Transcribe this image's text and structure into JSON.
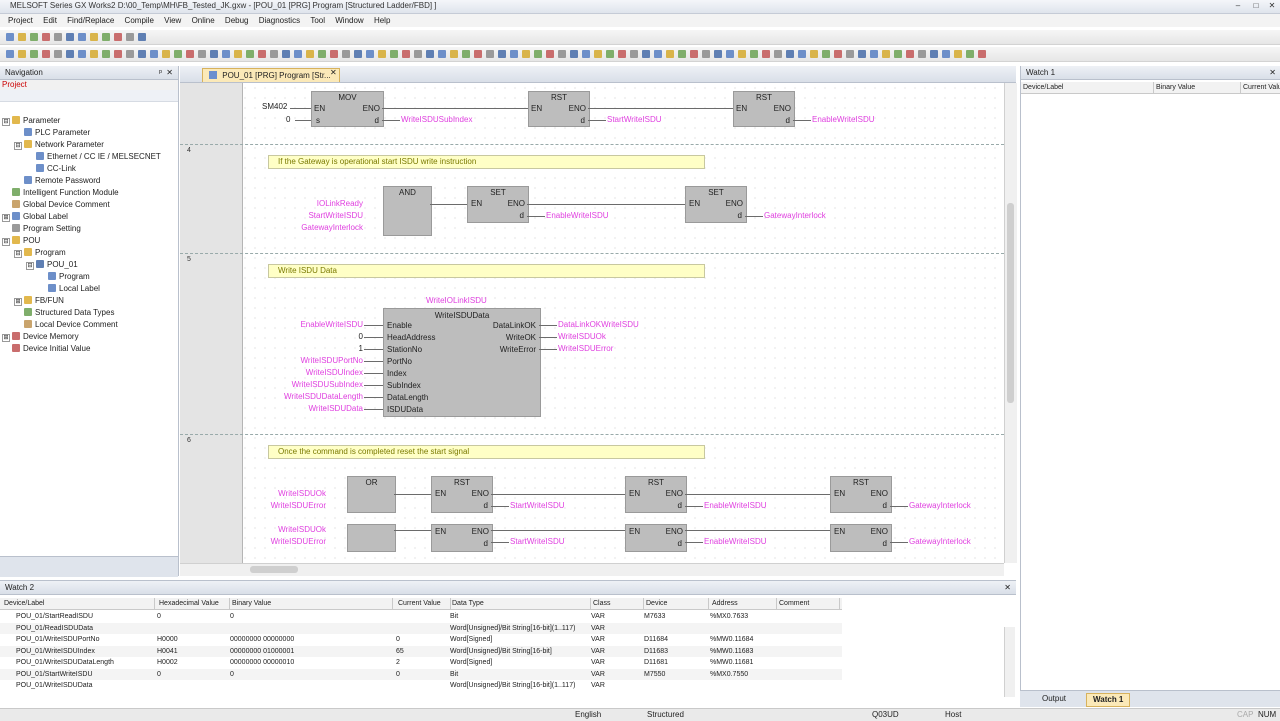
{
  "window": {
    "title": "MELSOFT Series GX Works2 D:\\00_Temp\\MH\\FB_Tested_JK.gxw - [POU_01 [PRG] Program [Structured Ladder/FBD] ]",
    "minimize": "–",
    "restore": "□",
    "close": "✕"
  },
  "menu": [
    "Project",
    "Edit",
    "Find/Replace",
    "Compile",
    "View",
    "Online",
    "Debug",
    "Diagnostics",
    "Tool",
    "Window",
    "Help"
  ],
  "nav": {
    "title": "Navigation",
    "pin": "ᵖ",
    "close": "✕",
    "project_label": "Project",
    "tree": [
      {
        "label": "Parameter",
        "level": 0,
        "expander": "⊟",
        "icon": "folder-icon"
      },
      {
        "label": "PLC Parameter",
        "level": 1,
        "expander": "",
        "icon": "param-icon"
      },
      {
        "label": "Network Parameter",
        "level": 1,
        "expander": "⊟",
        "icon": "folder-icon"
      },
      {
        "label": "Ethernet / CC IE / MELSECNET",
        "level": 2,
        "expander": "",
        "icon": "param-icon"
      },
      {
        "label": "CC-Link",
        "level": 2,
        "expander": "",
        "icon": "param-icon"
      },
      {
        "label": "Remote Password",
        "level": 1,
        "expander": "",
        "icon": "param-icon"
      },
      {
        "label": "Intelligent Function Module",
        "level": 0,
        "expander": "",
        "icon": "module-icon"
      },
      {
        "label": "Global Device Comment",
        "level": 0,
        "expander": "",
        "icon": "comment-icon"
      },
      {
        "label": "Global Label",
        "level": 0,
        "expander": "⊞",
        "icon": "label-icon"
      },
      {
        "label": "Program Setting",
        "level": 0,
        "expander": "",
        "icon": "setting-icon"
      },
      {
        "label": "POU",
        "level": 0,
        "expander": "⊟",
        "icon": "folder-icon"
      },
      {
        "label": "Program",
        "level": 1,
        "expander": "⊟",
        "icon": "folder-icon"
      },
      {
        "label": "POU_01",
        "level": 2,
        "expander": "⊟",
        "icon": "program-icon"
      },
      {
        "label": "Program",
        "level": 3,
        "expander": "",
        "icon": "ladder-icon"
      },
      {
        "label": "Local Label",
        "level": 3,
        "expander": "",
        "icon": "label-icon"
      },
      {
        "label": "FB/FUN",
        "level": 1,
        "expander": "⊞",
        "icon": "folder-icon"
      },
      {
        "label": "Structured Data Types",
        "level": 1,
        "expander": "",
        "icon": "struct-icon"
      },
      {
        "label": "Local Device Comment",
        "level": 1,
        "expander": "",
        "icon": "comment-icon"
      },
      {
        "label": "Device Memory",
        "level": 0,
        "expander": "⊞",
        "icon": "memory-icon"
      },
      {
        "label": "Device Initial Value",
        "level": 0,
        "expander": "",
        "icon": "memory-icon"
      }
    ]
  },
  "editor": {
    "tab": "POU_01 [PRG] Program [Str...",
    "tab_close": "✕",
    "row_numbers": [
      "4",
      "5",
      "6"
    ],
    "comments": [
      "If the Gateway is operational start ISDU write instruction",
      "Write ISDU Data",
      "Once the command is completed reset the start signal"
    ],
    "row3": {
      "contact": "SM402",
      "mov_name": "MOV",
      "zero": "0",
      "mov_out": "WriteISDUSubIndex",
      "rst1_out": "StartWriteISDU",
      "rst2_out": "EnableWriteISDU"
    },
    "row4": {
      "and_name": "AND",
      "in1": "IOLinkReady",
      "in2": "StartWriteISDU",
      "in3": "GatewayInterlock",
      "set1_out": "EnableWriteISDU",
      "set2_out": "GatewayInterlock"
    },
    "row5": {
      "instance": "WriteIOLinkISDU",
      "fb_name": "WriteISDUData",
      "inputs": [
        "Enable",
        "HeadAddress",
        "StationNo",
        "PortNo",
        "Index",
        "SubIndex",
        "DataLength",
        "ISDUData"
      ],
      "input_vars": [
        "EnableWriteISDU",
        "0",
        "1",
        "WriteISDUPortNo",
        "WriteISDUIndex",
        "WriteISDUSubIndex",
        "WriteISDUDataLength",
        "WriteISDUData"
      ],
      "outputs": [
        "DataLinkOK",
        "WriteOK",
        "WriteError"
      ],
      "output_vars": [
        "DataLinkOKWriteISDU",
        "WriteISDUOk",
        "WriteISDUError"
      ]
    },
    "row6": {
      "or_name": "OR",
      "in1": "WriteISDUOk",
      "in2": "WriteISDUError",
      "rst1_out": "StartWriteISDU",
      "rst2_out": "EnableWriteISDU",
      "rst3_out": "GatewayInterlock"
    },
    "row7": {
      "in1": "WriteISDUOk",
      "in2": "WriteISDUError",
      "rst1_out": "StartWriteISDU",
      "rst2_out": "EnableWriteISDU",
      "rst3_out": "GatewayInterlock"
    },
    "pins": {
      "en": "EN",
      "eno": "ENO",
      "d": "d",
      "s": "s",
      "rst": "RST",
      "set": "SET"
    }
  },
  "watch1": {
    "title": "Watch 1",
    "columns": [
      "Device/Label",
      "Binary Value",
      "Current Value"
    ],
    "tabs": [
      "Output",
      "Watch 1"
    ]
  },
  "watch2": {
    "title": "Watch 2",
    "columns": [
      "Device/Label",
      "Hexadecimal Value",
      "Binary Value",
      "Current Value",
      "Data Type",
      "Class",
      "Device",
      "Address",
      "Comment"
    ],
    "rows": [
      [
        "POU_01/StartReadISDU",
        "0",
        "0",
        "",
        "Bit",
        "VAR",
        "M7633",
        "%MX0.7633",
        ""
      ],
      [
        "POU_01/ReadISDUData",
        "",
        "",
        "",
        "Word[Unsigned]/Bit String[16-bit](1..117)",
        "VAR",
        "",
        "",
        ""
      ],
      [
        "POU_01/WriteISDUPortNo",
        "H0000",
        "00000000 00000000",
        "0",
        "Word[Signed]",
        "VAR",
        "D11684",
        "%MW0.11684",
        ""
      ],
      [
        "POU_01/WriteISDUIndex",
        "H0041",
        "00000000 01000001",
        "65",
        "Word[Unsigned]/Bit String[16-bit]",
        "VAR",
        "D11683",
        "%MW0.11683",
        ""
      ],
      [
        "POU_01/WriteISDUDataLength",
        "H0002",
        "00000000 00000010",
        "2",
        "Word[Signed]",
        "VAR",
        "D11681",
        "%MW0.11681",
        ""
      ],
      [
        "POU_01/StartWriteISDU",
        "0",
        "0",
        "0",
        "Bit",
        "VAR",
        "M7550",
        "%MX0.7550",
        ""
      ],
      [
        "POU_01/WriteISDUData",
        "",
        "",
        "",
        "Word[Unsigned]/Bit String[16-bit](1..117)",
        "VAR",
        "",
        "",
        ""
      ]
    ]
  },
  "status": {
    "language": "English",
    "mode": "Structured",
    "cpu": "Q03UD",
    "host": "Host",
    "cap": "CAP",
    "num": "NUM"
  }
}
